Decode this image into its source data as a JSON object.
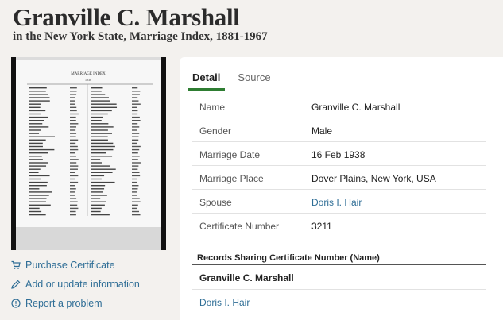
{
  "header": {
    "title": "Granville C. Marshall",
    "subtitle": "in the New York State, Marriage Index, 1881-1967"
  },
  "thumbnail": {
    "heading": "MARRIAGE INDEX",
    "year": "1938"
  },
  "actions": [
    {
      "label": "Purchase Certificate",
      "icon": "cart-icon"
    },
    {
      "label": "Add or update information",
      "icon": "pencil-icon"
    },
    {
      "label": "Report a problem",
      "icon": "alert-icon"
    }
  ],
  "tabs": [
    {
      "label": "Detail",
      "active": true
    },
    {
      "label": "Source",
      "active": false
    }
  ],
  "details": [
    {
      "key": "Name",
      "value": "Granville C. Marshall"
    },
    {
      "key": "Gender",
      "value": "Male"
    },
    {
      "key": "Marriage Date",
      "value": "16 Feb 1938"
    },
    {
      "key": "Marriage Place",
      "value": "Dover Plains, New York, USA"
    },
    {
      "key": "Spouse",
      "value": "Doris I. Hair"
    },
    {
      "key": "Certificate Number",
      "value": "3211"
    }
  ],
  "shared": {
    "heading": "Records Sharing Certificate Number (Name)",
    "items": [
      "Granville C. Marshall",
      "Doris I. Hair"
    ]
  },
  "colors": {
    "link": "#2f6e96",
    "tab_underline": "#2e7d32",
    "background": "#f3f1ee"
  }
}
